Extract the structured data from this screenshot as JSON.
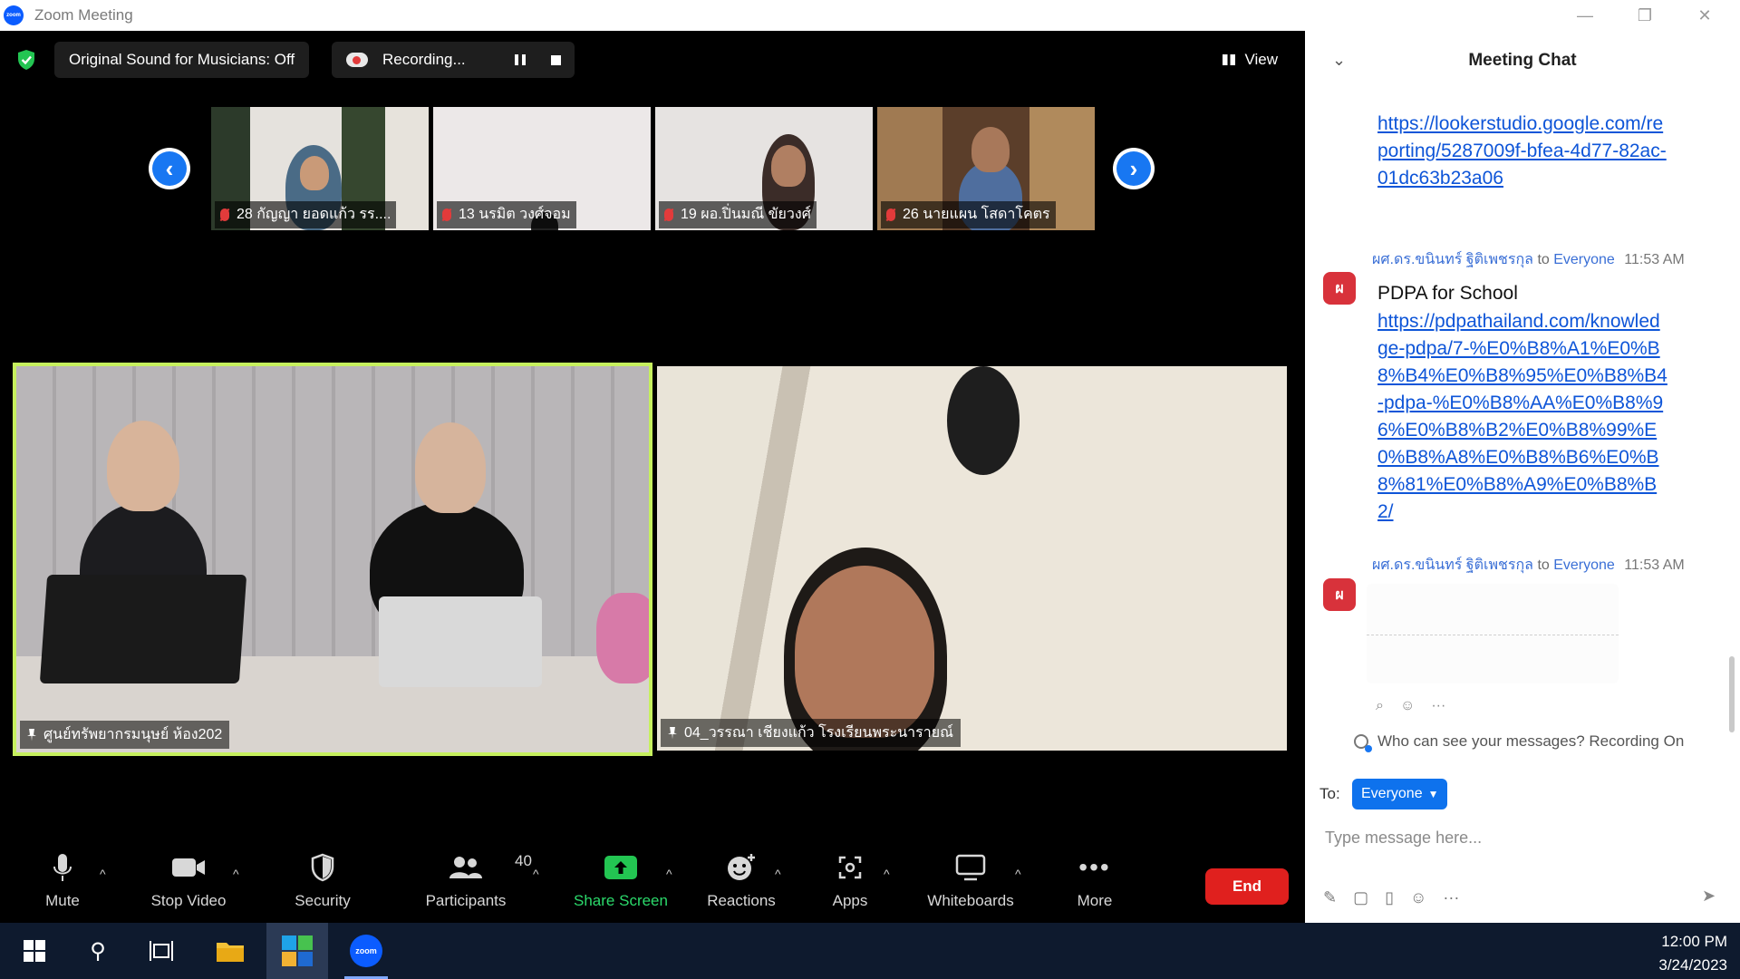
{
  "window": {
    "title": "Zoom Meeting"
  },
  "topbar": {
    "sound_label": "Original Sound for Musicians: Off",
    "recording_label": "Recording...",
    "view_label": "View"
  },
  "thumbnails": [
    {
      "name": "28 กัญญา ยอดแก้ว รร...."
    },
    {
      "name": "13 นรมิต วงศ์จอม"
    },
    {
      "name": "19 ผอ.ปิ่นมณี ขัยวงศ์"
    },
    {
      "name": "26 นายแผน โสดาโคตร"
    }
  ],
  "main_videos": {
    "left_name": "ศูนย์ทรัพยากรมนุษย์ ห้อง202",
    "right_name": "04_วรรณา เชียงแก้ว โรงเรียนพระนารายณ์"
  },
  "toolbar": {
    "mute": "Mute",
    "stop_video": "Stop Video",
    "security": "Security",
    "participants": "Participants",
    "participants_count": "40",
    "share_screen": "Share Screen",
    "reactions": "Reactions",
    "apps": "Apps",
    "whiteboards": "Whiteboards",
    "more": "More",
    "end": "End"
  },
  "chat": {
    "title": "Meeting Chat",
    "messages": [
      {
        "link": "https://lookerstudio.google.com/reporting/5287009f-bfea-4d77-82ac-01dc63b23a06"
      },
      {
        "sender": "ผศ.ดร.ขนินทร์ ฐิติเพชรกุล",
        "to": "to",
        "recipient": "Everyone",
        "time": "11:53 AM",
        "avatar": "ผ",
        "text": "PDPA for School",
        "link": "https://pdpathailand.com/knowledge-pdpa/7-%E0%B8%A1%E0%B8%B4%E0%B8%95%E0%B8%B4-pdpa-%E0%B8%AA%E0%B8%96%E0%B8%B2%E0%B8%99%E0%B8%A8%E0%B8%B6%E0%B8%81%E0%B8%A9%E0%B8%B2/"
      },
      {
        "sender": "ผศ.ดร.ขนินทร์ ฐิติเพชรกุล",
        "to": "to",
        "recipient": "Everyone",
        "time": "11:53 AM",
        "avatar": "ผ"
      }
    ],
    "privacy_note": "Who can see your messages? Recording On",
    "to_label": "To:",
    "to_value": "Everyone",
    "input_placeholder": "Type message here..."
  },
  "taskbar": {
    "zoom_label": "zoom",
    "time": "12:00 PM",
    "date": "3/24/2023"
  },
  "colors": {
    "accent": "#0e72ed",
    "end_red": "#e0201e",
    "share_green": "#2bd96b",
    "active_speaker": "#c6f05e"
  }
}
